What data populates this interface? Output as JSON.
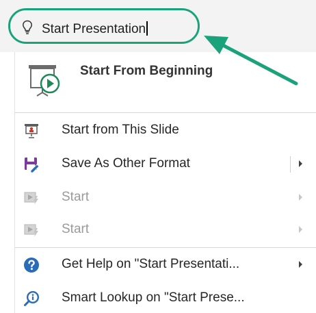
{
  "search": {
    "text": "Start Presentation",
    "icon": "lightbulb-icon",
    "highlight_color": "#1aa27a"
  },
  "menu": {
    "featured": {
      "label": "Start From Beginning",
      "icon": "slideshow-play-icon"
    },
    "items": [
      {
        "label": "Start from This Slide",
        "icon": "presenter-icon",
        "enabled": true,
        "has_submenu": false
      },
      {
        "label": "Save As Other Format",
        "icon": "save-as-icon",
        "enabled": true,
        "has_submenu": true
      },
      {
        "label": "Start",
        "icon": "start-icon",
        "enabled": false,
        "has_submenu": true
      },
      {
        "label": "Start",
        "icon": "start-icon",
        "enabled": false,
        "has_submenu": true
      },
      {
        "label": "Get Help on \"Start Presentati...",
        "icon": "help-icon",
        "enabled": true,
        "has_submenu": true
      },
      {
        "label": "Smart Lookup on \"Start Prese...",
        "icon": "smart-lookup-icon",
        "enabled": true,
        "has_submenu": false
      }
    ]
  },
  "colors": {
    "accent": "#1aa27a",
    "help_blue": "#2b6cb8",
    "save_purple": "#7a3b9c"
  }
}
